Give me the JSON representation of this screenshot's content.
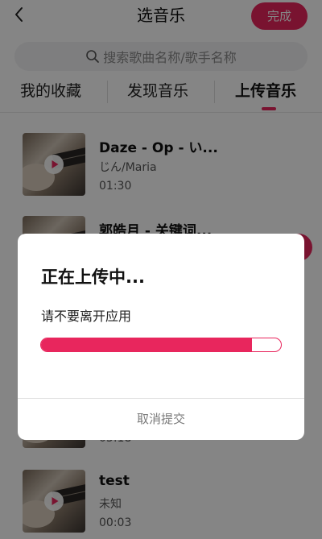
{
  "header": {
    "title": "选音乐",
    "done_label": "完成"
  },
  "search": {
    "placeholder": "搜索歌曲名称/歌手名称"
  },
  "tabs": [
    {
      "label": "我的收藏",
      "active": false
    },
    {
      "label": "发现音乐",
      "active": false
    },
    {
      "label": "上传音乐",
      "active": true
    }
  ],
  "songs": [
    {
      "title": "Daze - Op - い...",
      "artist": "じん/Maria",
      "duration": "01:30"
    },
    {
      "title": "郭皓月 - 关键词...",
      "artist": "",
      "duration": ""
    },
    {
      "title": "",
      "artist": "",
      "duration": "05:18"
    },
    {
      "title": "test",
      "artist": "未知",
      "duration": "00:03"
    }
  ],
  "dialog": {
    "title": "正在上传中...",
    "message": "请不要离开应用",
    "progress": 0.88,
    "cancel_label": "取消提交"
  },
  "colors": {
    "accent": "#e8265d",
    "overlay": "rgba(0,0,0,0.48)"
  },
  "icons": [
    "back-arrow-icon",
    "search-icon",
    "play-icon"
  ]
}
